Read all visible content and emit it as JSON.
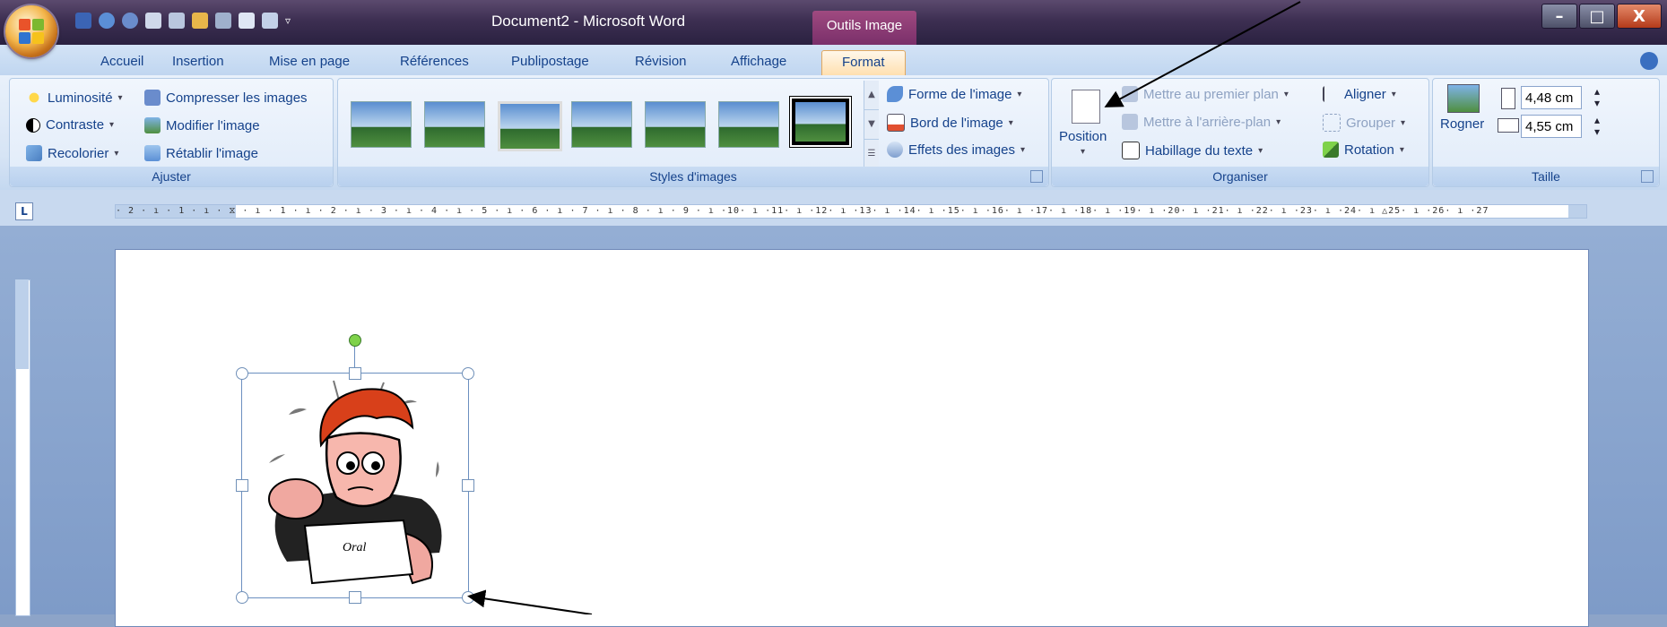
{
  "window": {
    "title": "Document2 - Microsoft Word",
    "contextual_tab": "Outils Image",
    "controls": [
      "–",
      "□",
      "X"
    ]
  },
  "tabs": [
    "Accueil",
    "Insertion",
    "Mise en page",
    "Références",
    "Publipostage",
    "Révision",
    "Affichage",
    "Format"
  ],
  "active_tab": "Format",
  "ribbon": {
    "ajuster": {
      "label": "Ajuster",
      "luminosite": "Luminosité",
      "contraste": "Contraste",
      "recolorier": "Recolorier",
      "compresser": "Compresser les images",
      "modifier": "Modifier l'image",
      "retablir": "Rétablir l'image"
    },
    "styles": {
      "label": "Styles d'images",
      "forme": "Forme de l'image",
      "bord": "Bord de l'image",
      "effets": "Effets des images"
    },
    "organiser": {
      "label": "Organiser",
      "position": "Position",
      "premier_plan": "Mettre au premier plan",
      "arriere_plan": "Mettre à l'arrière-plan",
      "habillage": "Habillage du texte",
      "aligner": "Aligner",
      "grouper": "Grouper",
      "rotation": "Rotation"
    },
    "taille": {
      "label": "Taille",
      "rogner": "Rogner",
      "height_value": "4,48 cm",
      "width_value": "4,55 cm"
    }
  },
  "ruler": {
    "text": "· 2 · ı · 1 · ı · ⧖ · ı · 1 · ı · 2 · ı · 3 · ı · 4 · ı · 5 · ı · 6 · ı · 7 · ı · 8 · ı · 9 · ı ·10· ı ·11· ı ·12· ı ·13· ı ·14· ı ·15· ı ·16· ı ·17· ı ·18· ı ·19· ı ·20· ı ·21· ı ·22· ı ·23· ı ·24· ı △25· ı ·26· ı ·27",
    "tab_selector": "L"
  },
  "image": {
    "caption": "Oral"
  }
}
